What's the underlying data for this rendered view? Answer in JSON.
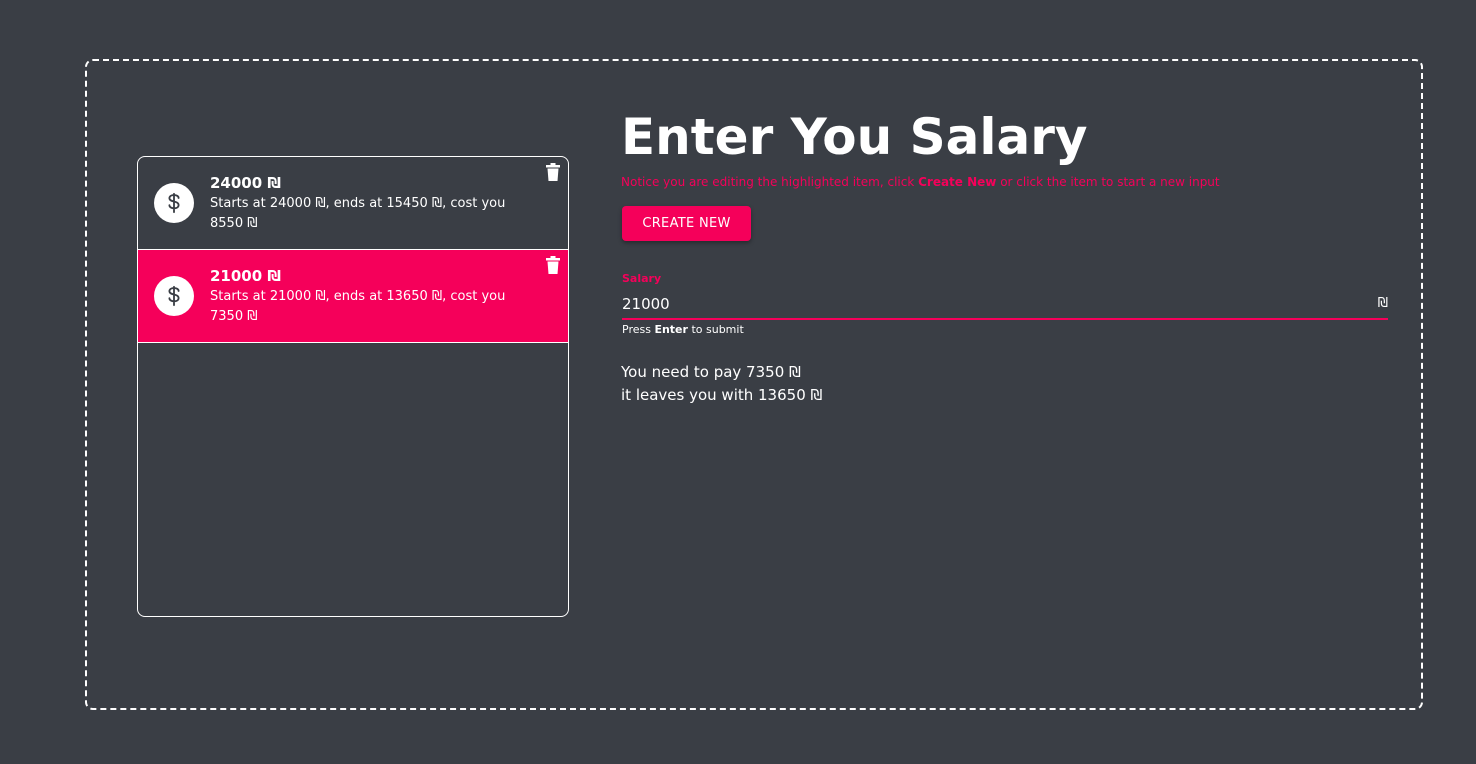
{
  "title": "Enter You Salary",
  "notice": {
    "before": "Notice you are editing the highlighted item, click ",
    "emphasis": "Create New",
    "after": " or click the item to start a new input"
  },
  "create_button_label": "CREATE NEW",
  "salary_field": {
    "label": "Salary",
    "value": "21000",
    "suffix": "₪",
    "helper_before": "Press ",
    "helper_key": "Enter",
    "helper_after": " to submit"
  },
  "result": {
    "pay_line": "You need to pay 7350 ₪",
    "leaves_line": "it leaves you with 13650 ₪"
  },
  "items": [
    {
      "title": "24000 ₪",
      "description": "Starts at 24000 ₪, ends at 15450 ₪, cost you 8550 ₪",
      "icon": "dollar-icon",
      "active": false
    },
    {
      "title": "21000 ₪",
      "description": "Starts at 21000 ₪, ends at 13650 ₪, cost you 7350 ₪",
      "icon": "dollar-icon",
      "active": true
    }
  ],
  "colors": {
    "background": "#3a3e45",
    "accent": "#f5005a",
    "text": "#ffffff"
  }
}
